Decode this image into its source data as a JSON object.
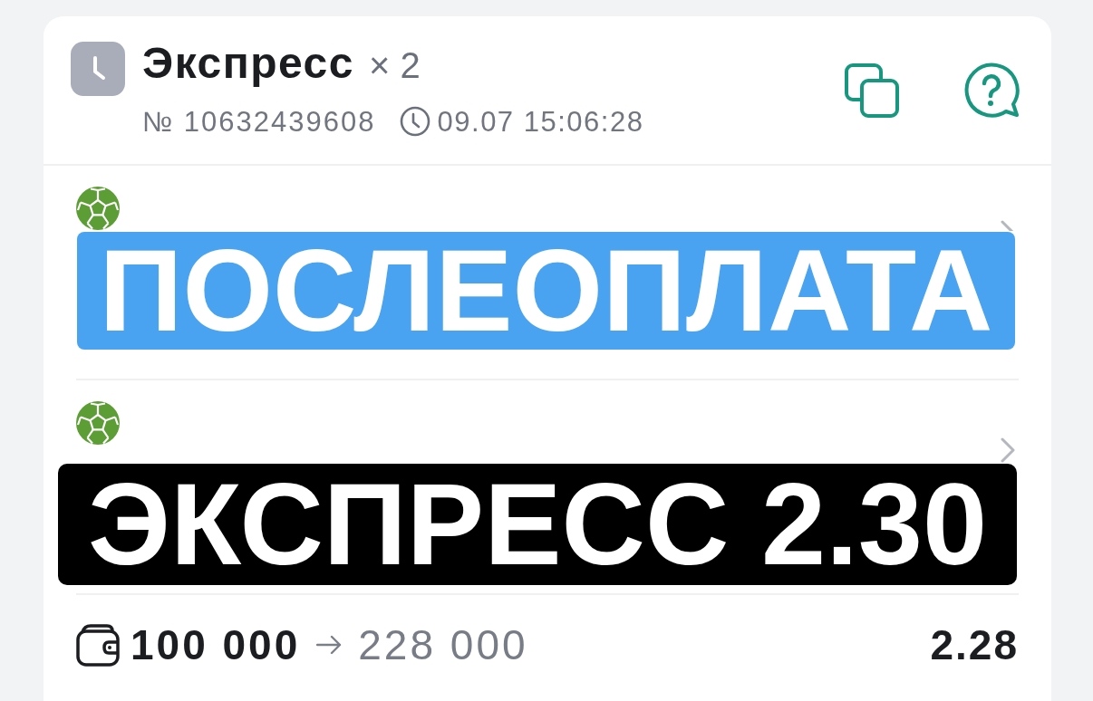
{
  "bet": {
    "title": "Экспресс",
    "count": "× 2",
    "number": "№ 10632439608",
    "datetime": "09.07 15:06:28"
  },
  "events": [
    {
      "kind": "football"
    },
    {
      "kind": "football"
    }
  ],
  "overlay_captions": [
    {
      "text": "ПОСЛЕОПЛАТА",
      "color": "#4aa3f0"
    },
    {
      "text": "ЭКСПРЕСС 2.30",
      "color": "#000000"
    }
  ],
  "footer": {
    "stake": "100 000",
    "payout": "228 000",
    "odds": "2.28"
  }
}
